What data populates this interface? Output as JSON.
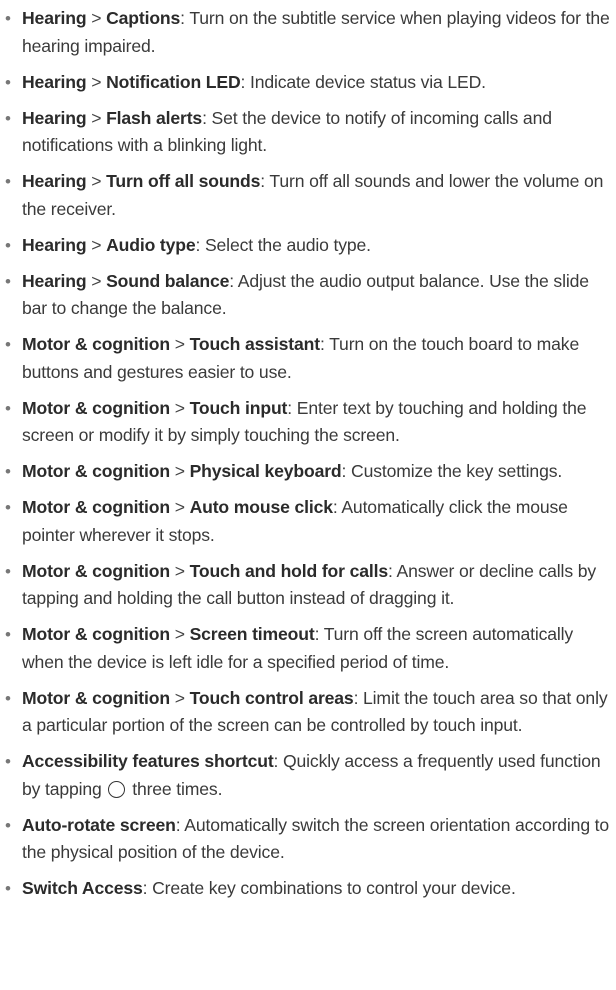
{
  "items": [
    {
      "cat": "Hearing",
      "sep": " > ",
      "opt": "Captions",
      "desc": ": Turn on the subtitle service when playing videos for the hearing impaired."
    },
    {
      "cat": "Hearing",
      "sep": " > ",
      "opt": "Notification LED",
      "desc": ": Indicate device status via LED."
    },
    {
      "cat": "Hearing",
      "sep": " > ",
      "opt": "Flash alerts",
      "desc": ": Set the device to notify of incoming calls and notifications with a blinking light."
    },
    {
      "cat": "Hearing",
      "sep": " > ",
      "opt": "Turn off all sounds",
      "desc": ": Turn off all sounds and lower the volume on the receiver."
    },
    {
      "cat": "Hearing",
      "sep": " > ",
      "opt": "Audio type",
      "desc": ": Select the audio type."
    },
    {
      "cat": "Hearing",
      "sep": " > ",
      "opt": "Sound balance",
      "desc": ": Adjust the audio output balance. Use the slide bar to change the balance."
    },
    {
      "cat": "Motor & cognition",
      "sep": " > ",
      "opt": "Touch assistant",
      "desc": ": Turn on the touch board to make buttons and gestures easier to use."
    },
    {
      "cat": "Motor & cognition",
      "sep": " > ",
      "opt": "Touch input",
      "desc": ": Enter text by touching and holding the screen or modify it by simply touching the screen."
    },
    {
      "cat": "Motor & cognition",
      "sep": " > ",
      "opt": "Physical keyboard",
      "desc": ": Customize the key settings."
    },
    {
      "cat": "Motor & cognition",
      "sep": " > ",
      "opt": "Auto mouse click",
      "desc": ": Automatically click the mouse pointer wherever it stops."
    },
    {
      "cat": "Motor & cognition",
      "sep": " > ",
      "opt": "Touch and hold for calls",
      "desc": ": Answer or decline calls by tapping and holding the call button instead of dragging it."
    },
    {
      "cat": "Motor & cognition",
      "sep": " > ",
      "opt": "Screen timeout",
      "desc": ": Turn off the screen automatically when the device is left idle for a specified period of time."
    },
    {
      "cat": "Motor & cognition",
      "sep": " > ",
      "opt": "Touch control areas",
      "desc": ": Limit the touch area so that only a particular portion of the screen can be controlled by touch input."
    }
  ],
  "shortcut": {
    "title": "Accessibility features shortcut",
    "desc_before": ": Quickly access a frequently used function by tapping",
    "icon": "home-key-icon",
    "desc_after": "three times."
  },
  "tail_items": [
    {
      "title": "Auto-rotate screen",
      "desc": ": Automatically switch the screen orientation according to the physical position of the device."
    },
    {
      "title": "Switch Access",
      "desc": ": Create key combinations to control your device."
    }
  ]
}
